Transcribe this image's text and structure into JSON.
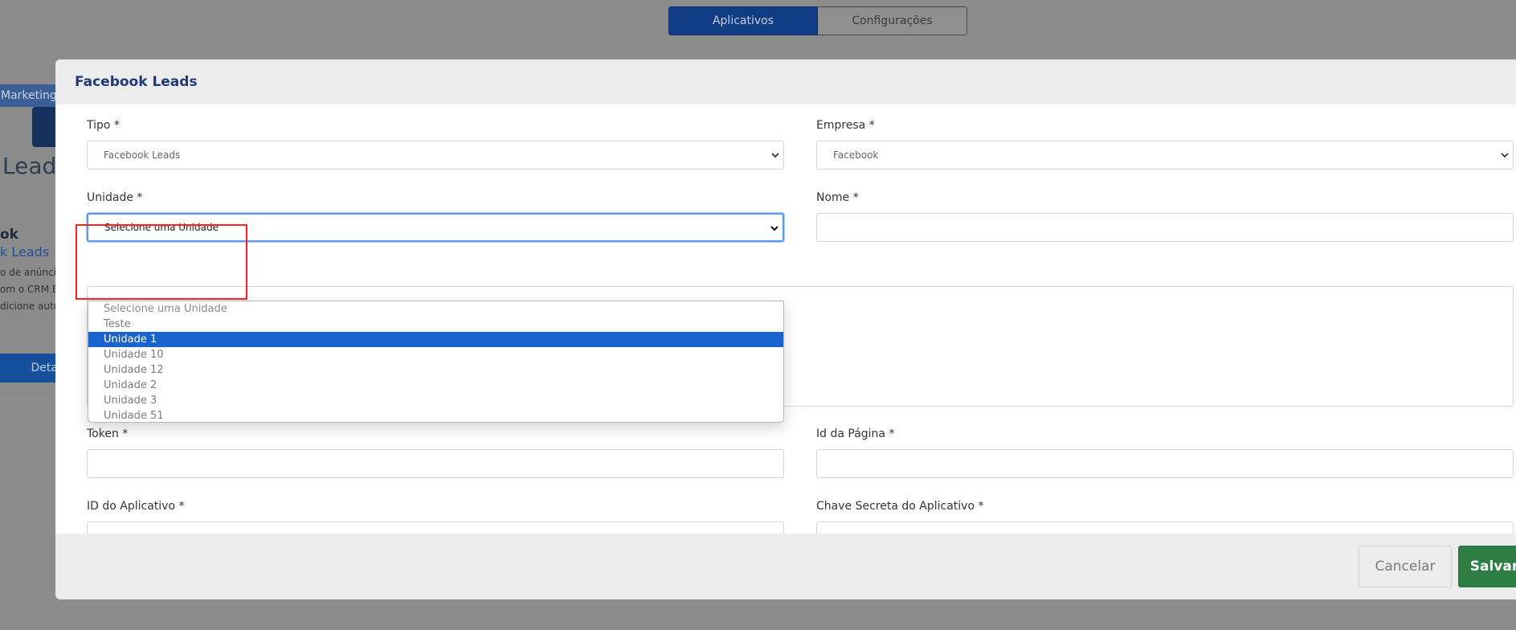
{
  "background": {
    "tabs": [
      {
        "label": "Aplicativos",
        "active": true
      },
      {
        "label": "Configurações",
        "active": false
      }
    ],
    "card": {
      "category": "Marketing",
      "logo_text": "Leads",
      "name": "ok",
      "subname": "k Leads",
      "desc_lines": [
        "o de anúncio",
        "om o CRM E",
        "dicione auto"
      ],
      "details_button": "Deta"
    }
  },
  "modal": {
    "title": "Facebook Leads",
    "fields": {
      "tipo": {
        "label": "Tipo *",
        "value": "Facebook Leads"
      },
      "empresa": {
        "label": "Empresa *",
        "value": "Facebook"
      },
      "unidade": {
        "label": "Unidade *",
        "value": "Selecione uma Unidade"
      },
      "nome": {
        "label": "Nome *",
        "value": ""
      },
      "token": {
        "label": "Token *",
        "value": ""
      },
      "id_pagina": {
        "label": "Id da Página *",
        "value": ""
      },
      "id_aplicativo": {
        "label": "ID do Aplicativo *",
        "value": ""
      },
      "chave_secreta": {
        "label": "Chave Secreta do Aplicativo *",
        "value": ""
      }
    },
    "unidade_options": [
      "Selecione uma Unidade",
      "Teste",
      "Unidade 1",
      "Unidade 10",
      "Unidade 12",
      "Unidade 2",
      "Unidade 3",
      "Unidade 51"
    ],
    "unidade_highlighted_option": "Unidade 1",
    "footer": {
      "cancel_label": "Cancelar",
      "save_label": "Salvar"
    }
  },
  "colors": {
    "title": "#1e3a78",
    "selected_option": "#1a62cc",
    "save_button": "#2e7d45",
    "annotation_box": "#ff2020"
  }
}
